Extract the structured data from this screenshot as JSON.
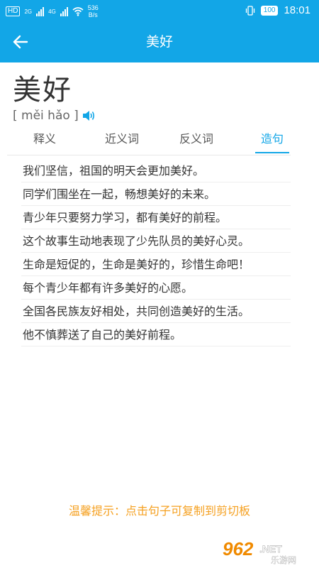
{
  "status_bar": {
    "hd": "HD",
    "net_a": "2G",
    "net_b": "4G",
    "speed_value": "536",
    "speed_unit": "B/s",
    "battery": "100",
    "time": "18:01"
  },
  "header": {
    "back_icon": "arrow-left-icon",
    "title": "美好"
  },
  "word": {
    "text": "美好",
    "pinyin": "[ měi hǎo ]",
    "speaker_icon": "speaker-icon"
  },
  "tabs": [
    {
      "label": "释义",
      "active": false
    },
    {
      "label": "近义词",
      "active": false
    },
    {
      "label": "反义词",
      "active": false
    },
    {
      "label": "造句",
      "active": true
    }
  ],
  "sentences": [
    "我们坚信，祖国的明天会更加美好。",
    "同学们围坐在一起，畅想美好的未来。",
    "青少年只要努力学习，都有美好的前程。",
    "这个故事生动地表现了少先队员的美好心灵。",
    "生命是短促的，生命是美好的，珍惜生命吧！",
    "每个青少年都有许多美好的心愿。",
    "全国各民族友好相处，共同创造美好的生活。",
    "他不慎葬送了自己的美好前程。"
  ],
  "tip": "温馨提示：点击句子可复制到剪切板",
  "watermark": {
    "brand": "962",
    "suffix": ".NET",
    "caption": "乐游网"
  },
  "colors": {
    "accent": "#12a6e7",
    "tip": "#f5a020"
  }
}
